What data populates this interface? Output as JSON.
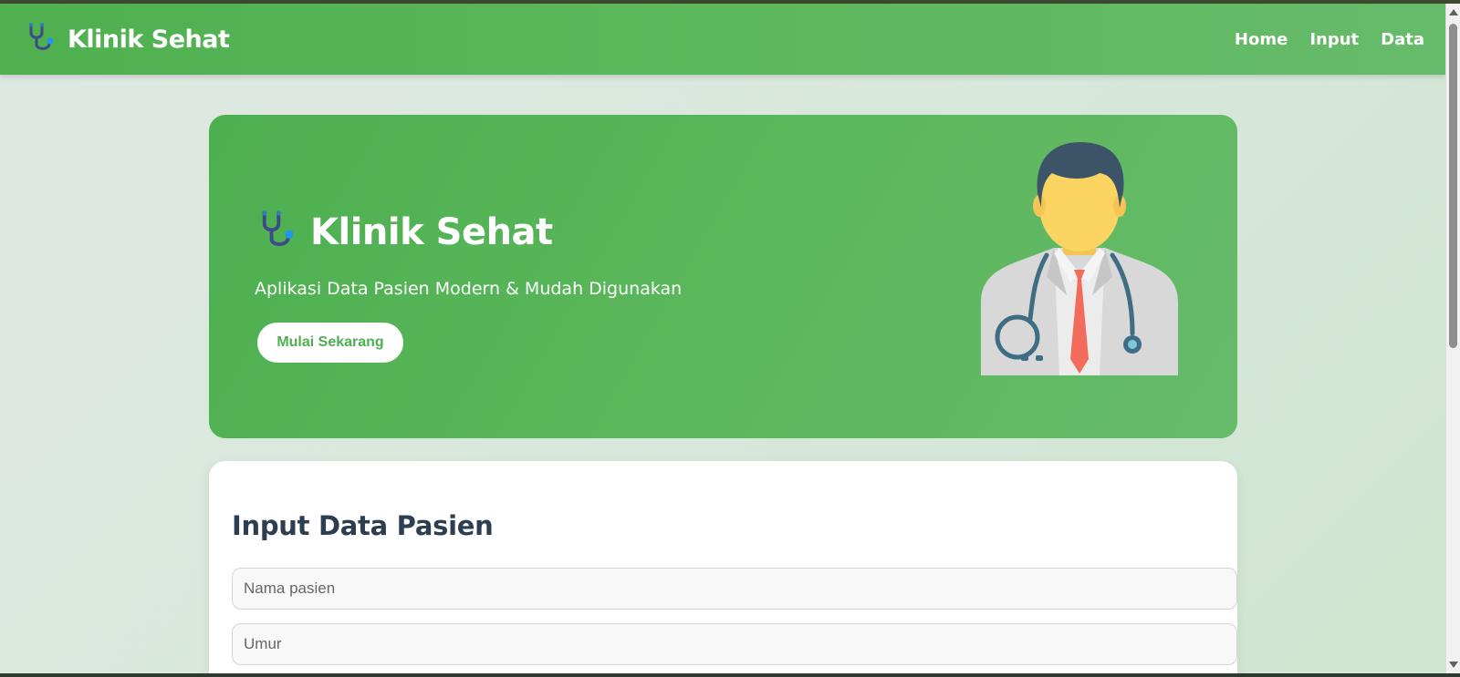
{
  "navbar": {
    "brand": "Klinik Sehat",
    "links": [
      {
        "label": "Home"
      },
      {
        "label": "Input"
      },
      {
        "label": "Data"
      }
    ]
  },
  "hero": {
    "title": "Klinik Sehat",
    "subtitle": "Aplikasi Data Pasien Modern & Mudah Digunakan",
    "cta_label": "Mulai Sekarang",
    "illustration": "doctor-illustration"
  },
  "form": {
    "title": "Input Data Pasien",
    "fields": [
      {
        "placeholder": "Nama pasien",
        "value": ""
      },
      {
        "placeholder": "Umur",
        "value": ""
      }
    ]
  },
  "colors": {
    "brand_green": "#5cb85c",
    "button_text": "#4caf50",
    "heading": "#2c3e50"
  },
  "icons": {
    "brand": "stethoscope-icon"
  }
}
